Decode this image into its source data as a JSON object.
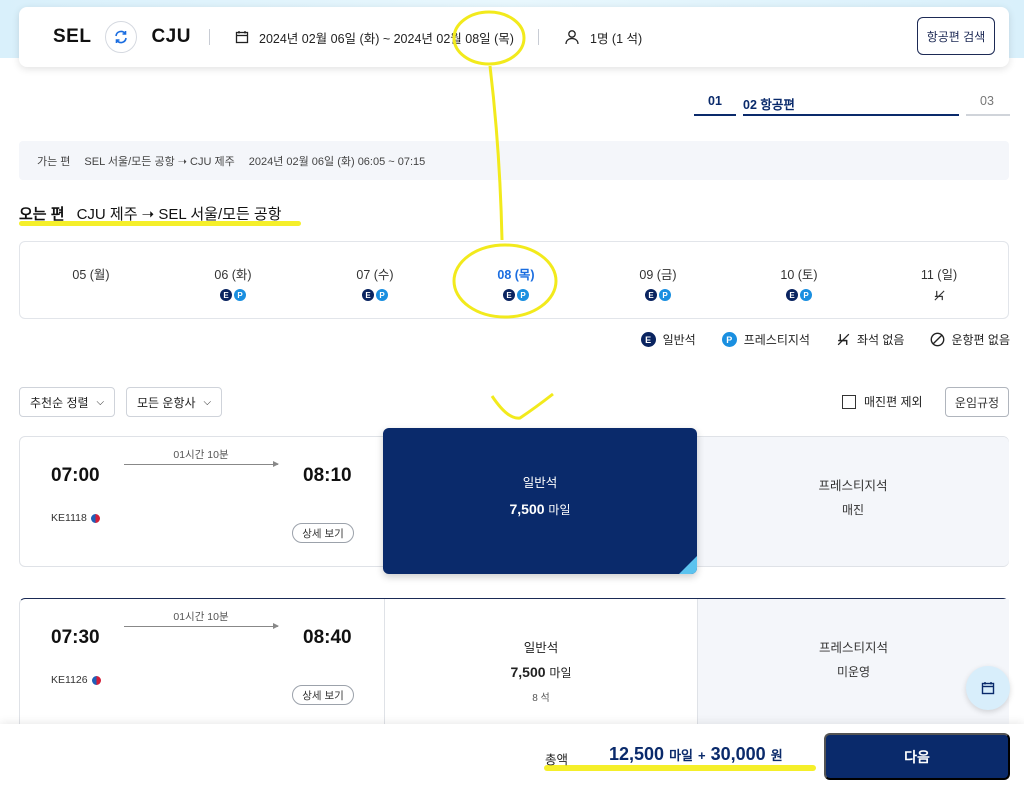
{
  "header": {
    "origin": "SEL",
    "destination": "CJU",
    "date_range": "2024년 02월 06일 (화) ~ 2024년 02월 08일 (목)",
    "passengers": "1명 (1 석)",
    "search_label": "항공편 검색"
  },
  "steps": {
    "step1": "01",
    "step2": "02  항공편",
    "step3": "03"
  },
  "outbound": {
    "label": "가는 편",
    "route": "SEL  서울/모든 공항 ➝ CJU  제주",
    "time": "2024년 02월 06일 (화) 06:05 ~ 07:15"
  },
  "return_title": {
    "label": "오는 편",
    "route": "CJU  제주 ➝ SEL  서울/모든 공항"
  },
  "dates": [
    {
      "label": "05 (월)",
      "badges": ""
    },
    {
      "label": "06 (화)",
      "badges": "EP"
    },
    {
      "label": "07 (수)",
      "badges": "EP"
    },
    {
      "label": "08 (목)",
      "badges": "EP"
    },
    {
      "label": "09 (금)",
      "badges": "EP"
    },
    {
      "label": "10 (토)",
      "badges": "EP"
    },
    {
      "label": "11 (일)",
      "badges": "none"
    }
  ],
  "legend": {
    "economy": "일반석",
    "prestige": "프레스티지석",
    "no_seat": "좌석 없음",
    "no_flight": "운항편 없음",
    "e_badge": "E",
    "p_badge": "P"
  },
  "filters": {
    "sort": "추천순 정렬",
    "carrier": "모든 운항사",
    "exclude": "매진편 제외",
    "rules": "운임규정"
  },
  "flights": [
    {
      "dep": "07:00",
      "arr": "08:10",
      "duration": "01시간 10분",
      "flight_no": "KE1118",
      "detail": "상세 보기",
      "economy": {
        "name": "일반석",
        "miles": "7,500",
        "unit": "마일"
      },
      "prestige": {
        "name": "프레스티지석",
        "status": "매진"
      }
    },
    {
      "dep": "07:30",
      "arr": "08:40",
      "duration": "01시간 10분",
      "flight_no": "KE1126",
      "detail": "상세 보기",
      "economy": {
        "name": "일반석",
        "miles": "7,500",
        "unit": "마일",
        "seats": "8 석"
      },
      "prestige": {
        "name": "프레스티지석",
        "status": "미운영"
      }
    }
  ],
  "footer": {
    "total_label": "총액",
    "miles": "12,500",
    "miles_unit": "마일",
    "plus": "+",
    "won": "30,000",
    "won_unit": "원",
    "next": "다음"
  },
  "colors": {
    "navy": "#0a2a6b",
    "accent_blue": "#1a6de0",
    "highlight": "#f5ef2a"
  }
}
